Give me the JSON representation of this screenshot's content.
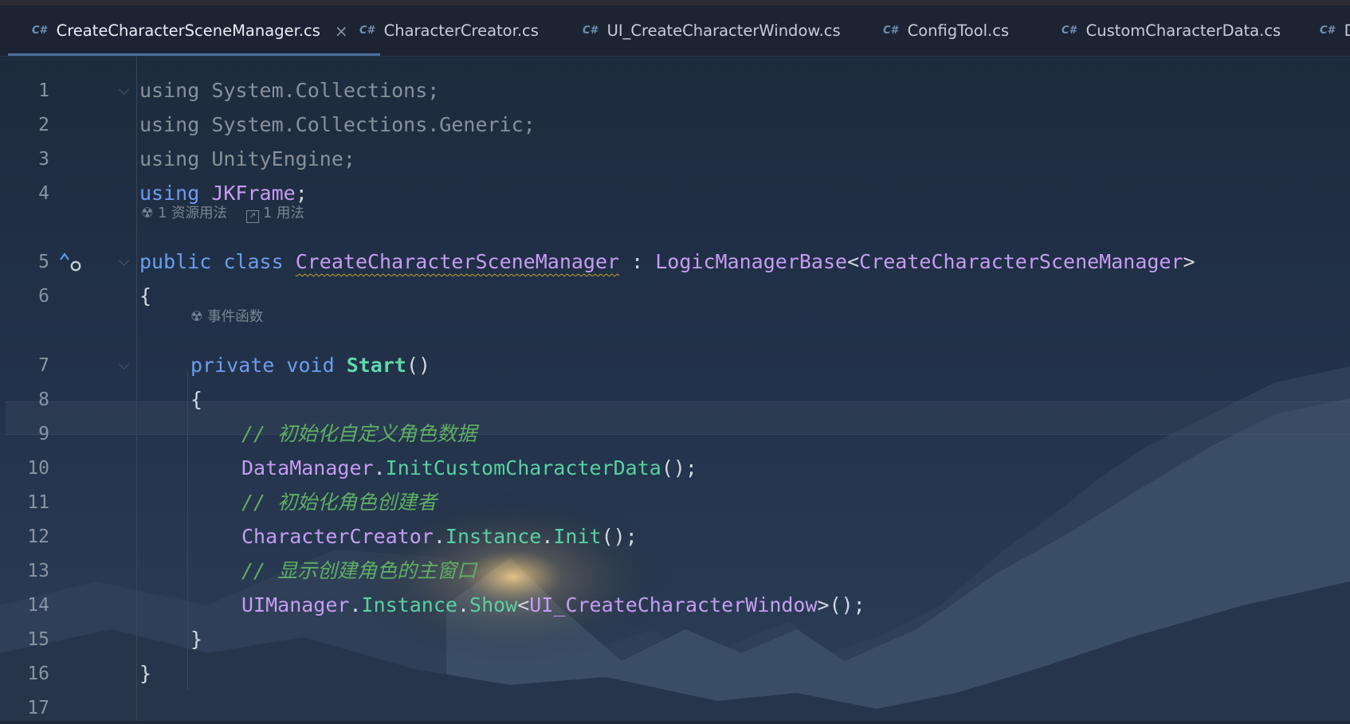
{
  "tabs": [
    {
      "icon": "C#",
      "label": "CreateCharacterSceneManager.cs",
      "active": true,
      "close": "×"
    },
    {
      "icon": "C#",
      "label": "CharacterCreator.cs"
    },
    {
      "icon": "C#",
      "label": "UI_CreateCharacterWindow.cs"
    },
    {
      "icon": "C#",
      "label": "ConfigTool.cs"
    },
    {
      "icon": "C#",
      "label": "CustomCharacterData.cs"
    },
    {
      "icon": "C#",
      "label": "D"
    }
  ],
  "hints": {
    "class_usages": "1 资源用法",
    "class_refs": "1 用法",
    "event_function": "事件函数"
  },
  "code": {
    "l1": {
      "num": "1",
      "kw": "using",
      "rest": " System.Collections;"
    },
    "l2": {
      "num": "2",
      "kw": "using",
      "rest": " System.Collections.Generic;"
    },
    "l3": {
      "num": "3",
      "kw": "using",
      "rest": " UnityEngine;"
    },
    "l4": {
      "num": "4",
      "kw": "using",
      "name": "JKFrame",
      "semi": ";"
    },
    "l5": {
      "num": "5",
      "kw1": "public",
      "kw2": "class",
      "cls": "CreateCharacterSceneManager",
      "colon": " : ",
      "base": "LogicManagerBase",
      "lt": "<",
      "gen": "CreateCharacterSceneManager",
      "gt": ">"
    },
    "l6": {
      "num": "6",
      "text": "{"
    },
    "l7": {
      "num": "7",
      "kw1": "private",
      "kw2": "void",
      "method": "Start",
      "paren": "()"
    },
    "l8": {
      "num": "8",
      "text": "{"
    },
    "l9": {
      "num": "9",
      "comment": "// 初始化自定义角色数据"
    },
    "l10": {
      "num": "10",
      "type": "DataManager",
      "dot": ".",
      "method": "InitCustomCharacterData",
      "tail": "();"
    },
    "l11": {
      "num": "11",
      "comment": "// 初始化角色创建者"
    },
    "l12": {
      "num": "12",
      "type": "CharacterCreator",
      "dot1": ".",
      "prop": "Instance",
      "dot2": ".",
      "method": "Init",
      "tail": "();"
    },
    "l13": {
      "num": "13",
      "comment": "// 显示创建角色的主窗口"
    },
    "l14": {
      "num": "14",
      "type": "UIManager",
      "dot1": ".",
      "prop": "Instance",
      "dot2": ".",
      "method": "Show",
      "lt": "<",
      "gen": "UI_CreateCharacterWindow",
      "tail": ">();"
    },
    "l15": {
      "num": "15",
      "text": "}"
    },
    "l16": {
      "num": "16",
      "text": "}"
    },
    "l17": {
      "num": "17",
      "text": ""
    }
  }
}
